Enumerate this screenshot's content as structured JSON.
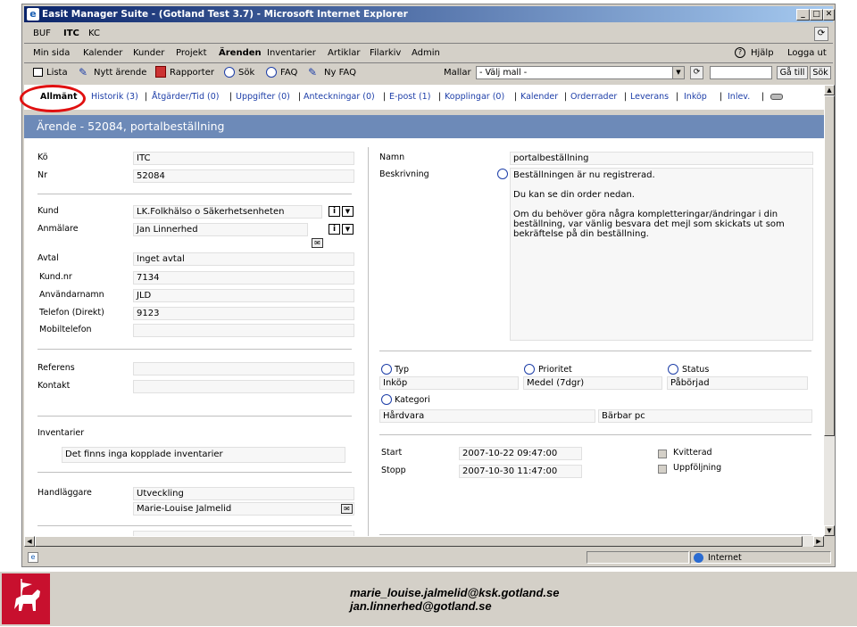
{
  "window": {
    "title": "Easit Manager Suite - (Gotland Test 3.7) - Microsoft Internet Explorer"
  },
  "topnav": [
    "BUF",
    "ITC",
    "KC"
  ],
  "menu": {
    "items": [
      "Min sida",
      "Kalender",
      "Kunder",
      "Projekt",
      "Ärenden",
      "Inventarier",
      "Artiklar",
      "Filarkiv",
      "Admin"
    ],
    "active": "Ärenden",
    "help": "Hjälp",
    "logout": "Logga ut"
  },
  "toolbar": {
    "list": "Lista",
    "new": "Nytt ärende",
    "reports": "Rapporter",
    "search": "Sök",
    "faq": "FAQ",
    "new_faq": "Ny FAQ",
    "templates_label": "Mallar",
    "template_value": "- Välj mall -",
    "goto": "Gå till",
    "search_btn": "Sök"
  },
  "tabs": [
    "Allmänt",
    "Historik (3)",
    "Åtgärder/Tid (0)",
    "Uppgifter (0)",
    "Anteckningar (0)",
    "E-post (1)",
    "Kopplingar (0)",
    "Kalender",
    "Orderrader",
    "Leverans",
    "Inköp",
    "Inlev."
  ],
  "heading": "Ärende - 52084, portalbeställning",
  "left": {
    "queue_label": "Kö",
    "queue": "ITC",
    "nr_label": "Nr",
    "nr": "52084",
    "customer_label": "Kund",
    "customer": "LK.Folkhälso o Säkerhetsenheten",
    "reporter_label": "Anmälare",
    "reporter": "Jan Linnerhed",
    "agreement_label": "Avtal",
    "agreement": "Inget avtal",
    "custnr_label": "Kund.nr",
    "custnr": "7134",
    "username_label": "Användarnamn",
    "username": "JLD",
    "phone_label": "Telefon (Direkt)",
    "phone": "9123",
    "mobile_label": "Mobiltelefon",
    "mobile": "",
    "reference_label": "Referens",
    "reference": "",
    "contact_label": "Kontakt",
    "contact": "",
    "inventory_label": "Inventarier",
    "inventory_msg": "Det finns inga kopplade inventarier",
    "handler_label": "Handläggare",
    "handler_group": "Utveckling",
    "handler_name": "Marie-Louise Jalmelid"
  },
  "right": {
    "name_label": "Namn",
    "name": "portalbeställning",
    "desc_label": "Beskrivning",
    "desc_lines": [
      "Beställningen är nu registrerad.",
      "",
      "Du kan se din order nedan.",
      "",
      "Om du behöver göra några kompletteringar/ändringar i din",
      "beställning, var vänlig besvara det mejl som skickats ut som",
      "bekräftelse på din beställning."
    ],
    "type_label": "Typ",
    "type": "Inköp",
    "priority_label": "Prioritet",
    "priority": "Medel (7dgr)",
    "status_label": "Status",
    "status": "Påbörjad",
    "category_label": "Kategori",
    "category": "Hårdvara",
    "category2": "Bärbar pc",
    "start_label": "Start",
    "start": "2007-10-22 09:47:00",
    "stop_label": "Stopp",
    "stop": "2007-10-30 11:47:00",
    "confirmed_label": "Kvitterad",
    "followup_label": "Uppföljning"
  },
  "status": {
    "zone": "Internet"
  },
  "footer": {
    "email1": "marie_louise.jalmelid@ksk.gotland.se",
    "email2": "jan.linnerhed@gotland.se"
  }
}
